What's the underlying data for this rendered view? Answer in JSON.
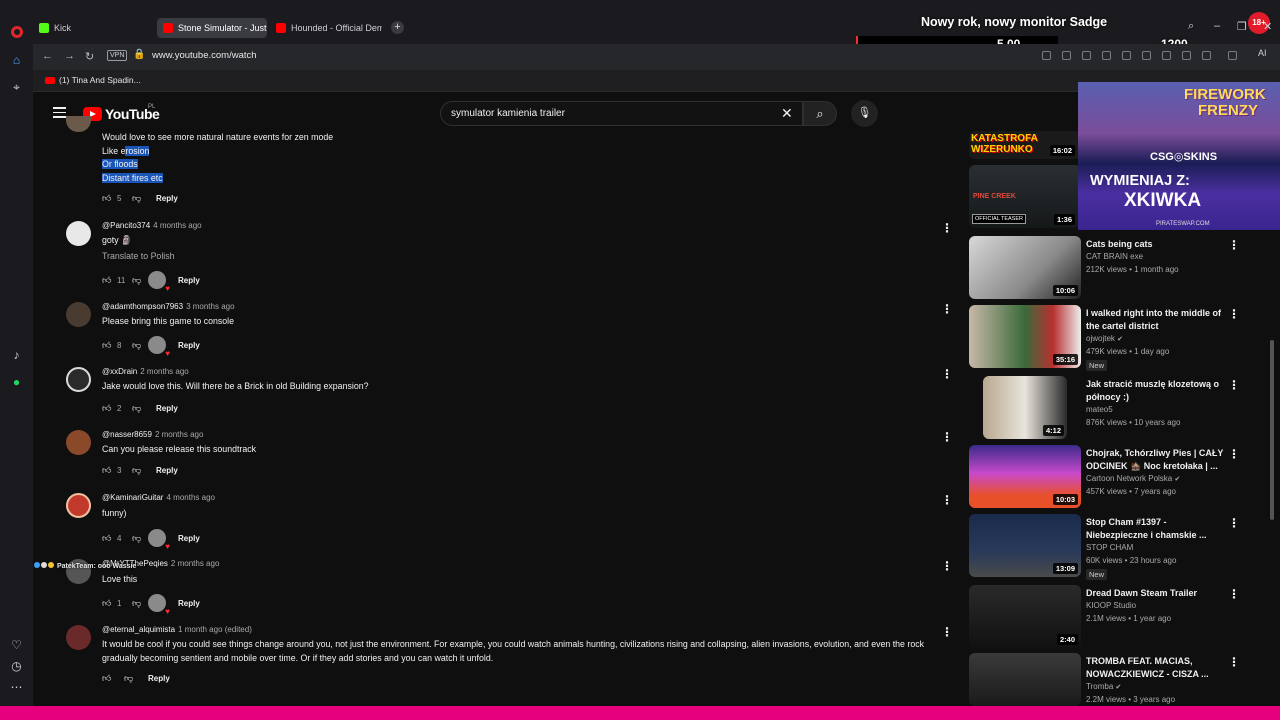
{
  "browser": {
    "tabs": [
      {
        "label": "Kick",
        "active": false
      },
      {
        "label": "Stone Simulator - Just Be",
        "active": true
      },
      {
        "label": "Hounded - Official Demo",
        "active": false
      }
    ],
    "url": "www.youtube.com/watch",
    "vpn_label": "VPN",
    "ai_label": "AI",
    "bookmark": "(1) Tina And Spadin..."
  },
  "stream_overlay": {
    "title": "Nowy rok, nowy monitor Sadge",
    "value1": "5.00",
    "value2": "1200",
    "badge": "18+"
  },
  "youtube": {
    "logo_text": "YouTube",
    "country": "PL",
    "search_query": "symulator kamienia trailer"
  },
  "comments": [
    {
      "text_lines": [
        "Would love to see more natural nature events for zen mode"
      ],
      "selected_prefix": "Like e",
      "selected_rest": "rosion",
      "selected_lines": [
        "Or floods",
        "Distant fires etc"
      ],
      "likes": "5",
      "reply": "Reply"
    },
    {
      "author": "@Pancito374",
      "time": "4 months ago",
      "text": "goty 🗿",
      "translate": "Translate to Polish",
      "likes": "11",
      "reply": "Reply"
    },
    {
      "author": "@adamthompson7963",
      "time": "3 months ago",
      "text": "Please bring this game to console",
      "likes": "8",
      "reply": "Reply"
    },
    {
      "author": "@xxDrain",
      "time": "2 months ago",
      "text": "Jake would love this. Will there be a Brick in old Building expansion?",
      "likes": "2",
      "reply": "Reply"
    },
    {
      "author": "@nasser8659",
      "time": "2 months ago",
      "text": "Can you please release this soundtrack",
      "likes": "3",
      "reply": "Reply"
    },
    {
      "author": "@KaminariGuitar",
      "time": "4 months ago",
      "text": "funny)",
      "likes": "4",
      "reply": "Reply"
    },
    {
      "author": "@MrYTThePeqies",
      "time": "2 months ago",
      "text": "Love this",
      "likes": "1",
      "reply": "Reply"
    },
    {
      "author": "@eternal_alquimista",
      "time": "1 month ago (edited)",
      "text": "It would be cool if you could see things change around you, not just the environment. For example, you could watch animals hunting, civilizations rising and collapsing, alien invasions, evolution, and even the rock gradually becoming sentient and mobile over time. Or if they add stories and you can watch it unfold.",
      "likes": "",
      "reply": "Reply"
    }
  ],
  "chat_overlay": {
    "text": "PatekTeam: ooo Wassie"
  },
  "ad": {
    "line1": "FIREWORK",
    "line2": "FRENZY",
    "line3": "CSG◎SKINS",
    "line4": "WYMIENIAJ Z:",
    "line5": "XKIWKA",
    "line6": "PIRATESWAP.COM"
  },
  "sidebar": [
    {
      "title": "KATASTROFA WIZERUNKO",
      "duration": "16:02"
    },
    {
      "title": "PINE CREEK",
      "badge": "OFFICIAL TEASER",
      "duration": "1:36"
    },
    {
      "title": "Cats being cats",
      "channel": "CAT BRAIN exe",
      "meta": "212K views • 1 month ago",
      "duration": "10:06"
    },
    {
      "title": "I walked right into the middle of the cartel district",
      "channel": "ojwojtek",
      "meta": "479K views • 1 day ago",
      "new": "New",
      "duration": "35:16"
    },
    {
      "title": "Jak stracić muszlę klozetową o północy :)",
      "channel": "mateo5",
      "meta": "876K views • 10 years ago",
      "duration": "4:12"
    },
    {
      "title": "Chojrak, Tchórzliwy Pies | CAŁY ODCINEK 🏚️ Noc kretołaka | ...",
      "channel": "Cartoon Network Polska",
      "meta": "457K views • 7 years ago",
      "duration": "10:03"
    },
    {
      "title": "Stop Cham #1397 - Niebezpieczne i chamskie ...",
      "channel": "STOP CHAM",
      "meta": "60K views • 23 hours ago",
      "new": "New",
      "duration": "13:09"
    },
    {
      "title": "Dread Dawn Steam Trailer",
      "channel": "KIOOP Studio",
      "meta": "2.1M views • 1 year ago",
      "duration": "2:40"
    },
    {
      "title": "TROMBA FEAT. MACIAS, NOWACZKIEWICZ - CISZA ...",
      "channel": "Tromba",
      "meta": "2.2M views • 3 years ago",
      "duration": ""
    }
  ]
}
